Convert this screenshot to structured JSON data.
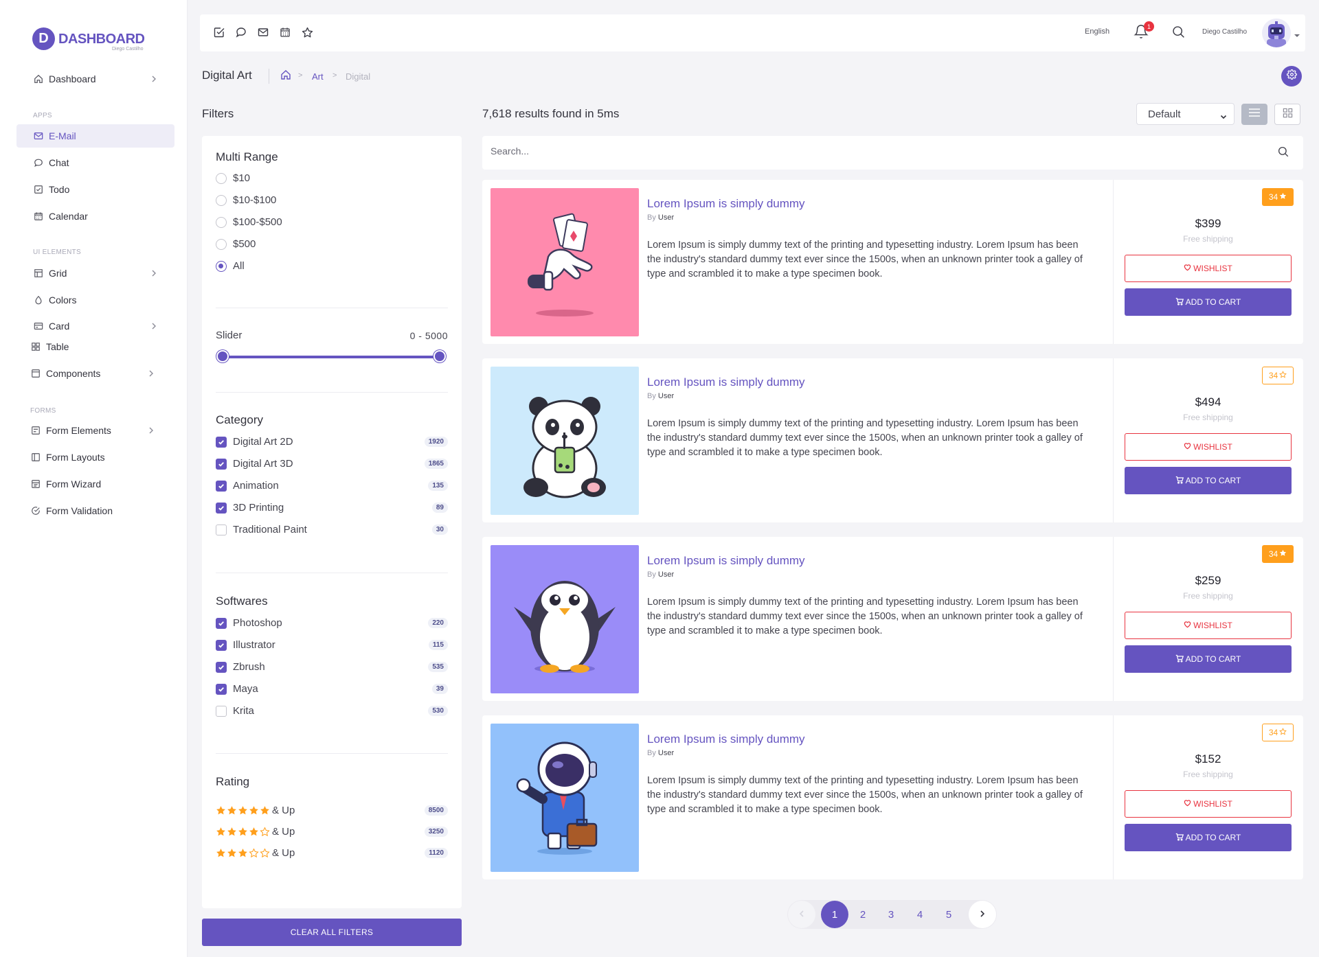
{
  "brand": {
    "letter": "D",
    "title": "DASHBOARD",
    "subtitle": "Diego Castilho"
  },
  "sidebar": {
    "items": [
      {
        "label": "Dashboard"
      },
      {
        "section": "APPS"
      },
      {
        "label": "E-Mail"
      },
      {
        "label": "Chat"
      },
      {
        "label": "Todo"
      },
      {
        "label": "Calendar"
      },
      {
        "section": "UI ELEMENTS"
      },
      {
        "label": "Grid"
      },
      {
        "label": "Colors"
      },
      {
        "label": "Card"
      },
      {
        "label": "Table"
      },
      {
        "label": "Components"
      },
      {
        "section": "FORMS"
      },
      {
        "label": "Form Elements"
      },
      {
        "label": "Form Layouts"
      },
      {
        "label": "Form Wizard"
      },
      {
        "label": "Form Validation"
      }
    ]
  },
  "topbar": {
    "icons": [
      "todo-icon",
      "chat-icon",
      "mail-icon",
      "calendar-icon",
      "star-icon"
    ],
    "language": "English",
    "notifications": "1",
    "user_name": "Diego Castilho"
  },
  "breadcrumb": {
    "title": "Digital Art",
    "items": [
      "Art",
      "Digital"
    ]
  },
  "filters": {
    "title": "Filters",
    "multi_range": {
      "title": "Multi Range",
      "options": [
        "$10",
        "$10-$100",
        "$100-$500",
        "$500",
        "All"
      ],
      "selected": "All"
    },
    "slider": {
      "label": "Slider",
      "range": "0 - 5000",
      "min": 0,
      "max": 5000
    },
    "category": {
      "title": "Category",
      "items": [
        {
          "label": "Digital Art 2D",
          "count": "1920",
          "checked": true
        },
        {
          "label": "Digital Art 3D",
          "count": "1865",
          "checked": true
        },
        {
          "label": "Animation",
          "count": "135",
          "checked": true
        },
        {
          "label": "3D Printing",
          "count": "89",
          "checked": true
        },
        {
          "label": "Traditional Paint",
          "count": "30",
          "checked": false
        }
      ]
    },
    "softwares": {
      "title": "Softwares",
      "items": [
        {
          "label": "Photoshop",
          "count": "220",
          "checked": true
        },
        {
          "label": "Illustrator",
          "count": "115",
          "checked": true
        },
        {
          "label": "Zbrush",
          "count": "535",
          "checked": true
        },
        {
          "label": "Maya",
          "count": "39",
          "checked": true
        },
        {
          "label": "Krita",
          "count": "530",
          "checked": false
        }
      ]
    },
    "rating": {
      "title": "Rating",
      "items": [
        {
          "stars": 5,
          "suffix": "& Up",
          "count": "8500"
        },
        {
          "stars": 4,
          "suffix": "& Up",
          "count": "3250"
        },
        {
          "stars": 3,
          "suffix": "& Up",
          "count": "1120"
        }
      ]
    },
    "clear_label": "CLEAR ALL FILTERS"
  },
  "results": {
    "summary": "7,618 results found in 5ms",
    "sort_selected": "Default",
    "search_placeholder": "Search..."
  },
  "products": [
    {
      "title": "Lorem Ipsum is simply dummy",
      "by": "By",
      "author": "User",
      "description": "Lorem Ipsum is simply dummy text of the printing and typesetting industry. Lorem Ipsum has been the industry's standard dummy text ever since the 1500s, when an unknown printer took a galley of type and scrambled it to make a type specimen book.",
      "rating": "34",
      "rating_style": "solid",
      "price": "$399",
      "shipping": "Free shipping",
      "wishlist_label": "WISHLIST",
      "cart_label": "ADD TO CART",
      "image": "magician-hand-cards",
      "bg": "#ff8aad"
    },
    {
      "title": "Lorem Ipsum is simply dummy",
      "by": "By",
      "author": "User",
      "description": "Lorem Ipsum is simply dummy text of the printing and typesetting industry. Lorem Ipsum has been the industry's standard dummy text ever since the 1500s, when an unknown printer took a galley of type and scrambled it to make a type specimen book.",
      "rating": "34",
      "rating_style": "outline",
      "price": "$494",
      "shipping": "Free shipping",
      "wishlist_label": "WISHLIST",
      "cart_label": "ADD TO CART",
      "image": "panda-boba",
      "bg": "#cdeafc"
    },
    {
      "title": "Lorem Ipsum is simply dummy",
      "by": "By",
      "author": "User",
      "description": "Lorem Ipsum is simply dummy text of the printing and typesetting industry. Lorem Ipsum has been the industry's standard dummy text ever since the 1500s, when an unknown printer took a galley of type and scrambled it to make a type specimen book.",
      "rating": "34",
      "rating_style": "solid",
      "price": "$259",
      "shipping": "Free shipping",
      "wishlist_label": "WISHLIST",
      "cart_label": "ADD TO CART",
      "image": "penguin",
      "bg": "#9a8cf8"
    },
    {
      "title": "Lorem Ipsum is simply dummy",
      "by": "By",
      "author": "User",
      "description": "Lorem Ipsum is simply dummy text of the printing and typesetting industry. Lorem Ipsum has been the industry's standard dummy text ever since the 1500s, when an unknown printer took a galley of type and scrambled it to make a type specimen book.",
      "rating": "34",
      "rating_style": "outline",
      "price": "$152",
      "shipping": "Free shipping",
      "wishlist_label": "WISHLIST",
      "cart_label": "ADD TO CART",
      "image": "astronaut-businessman",
      "bg": "#92c1fb"
    }
  ],
  "pagination": {
    "pages": [
      "1",
      "2",
      "3",
      "4",
      "5"
    ],
    "current": "1"
  },
  "colors": {
    "accent": "#6554c0",
    "danger": "#e8333f",
    "warning": "#ff9f1c"
  }
}
